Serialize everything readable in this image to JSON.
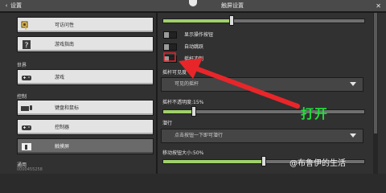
{
  "titlebar": {
    "back_arrow": "‹",
    "back_label": "设置",
    "page_title": "触屏设置",
    "close_label": "✕"
  },
  "sidebar": {
    "items": [
      {
        "label": "可访问性",
        "icon": "key-icon"
      },
      {
        "label": "游戏指南",
        "icon": "question-icon"
      }
    ],
    "sections": [
      {
        "title": "世界",
        "items": [
          {
            "label": "游戏",
            "icon": "controller-icon"
          }
        ]
      },
      {
        "title": "控制",
        "items": [
          {
            "label": "键盘和鼠标",
            "icon": "keyboard-icon"
          },
          {
            "label": "控制器",
            "icon": "controller-icon"
          },
          {
            "label": "触摸屏",
            "icon": "touch-icon",
            "selected": true
          }
        ]
      },
      {
        "title": "通用",
        "items": []
      }
    ],
    "version": "0000455258"
  },
  "main": {
    "top_slider_value": 0.34,
    "toggles": [
      {
        "label": "显示操作按钮",
        "on": false
      },
      {
        "label": "自动跳跃",
        "on": false
      },
      {
        "label": "摇杆冲刺",
        "on": false
      }
    ],
    "joystick_visibility": {
      "label": "摇杆可见度",
      "value": "可见的摇杆"
    },
    "joystick_opacity": {
      "label": "摇杆不透明度:15%",
      "value": 0.15
    },
    "sneak": {
      "label": "潜行",
      "value": "点击按钮一下即可潜行"
    },
    "button_size": {
      "label": "移动按钮大小:50%",
      "value": 0.5
    }
  },
  "annotation": {
    "text": "打开",
    "color": "#1fe03a",
    "arrow_color": "#e8262a"
  },
  "watermark": "@布鲁伊的生活"
}
